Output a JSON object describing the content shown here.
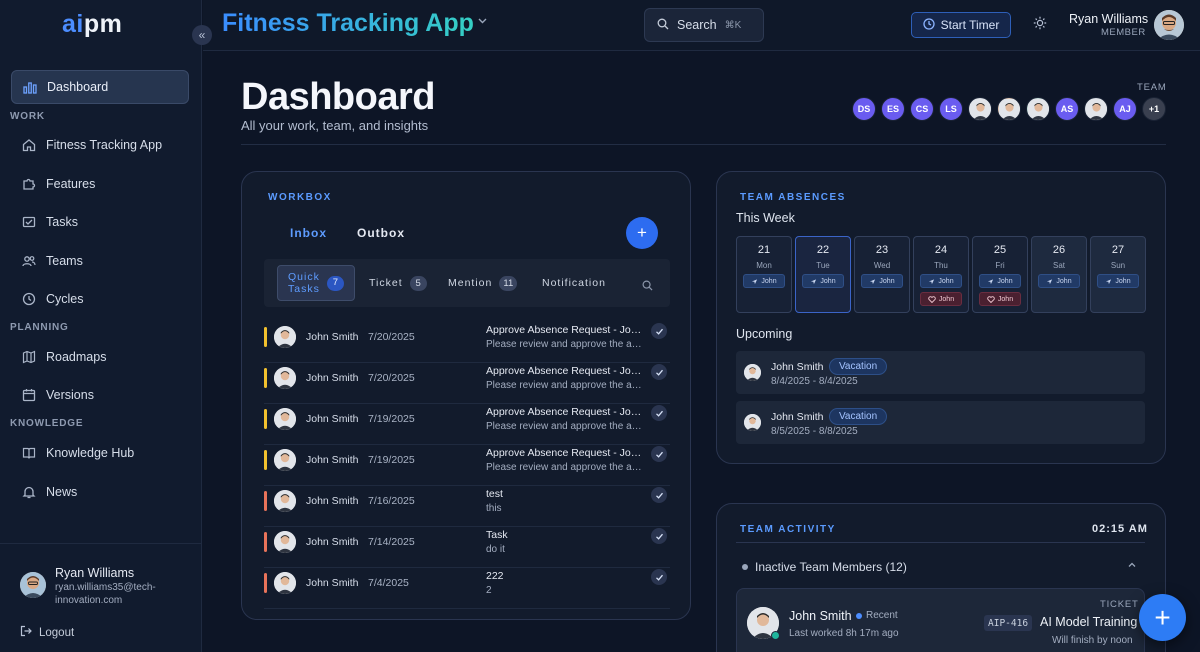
{
  "brand": {
    "logo_a": "ai",
    "logo_b": "pm"
  },
  "app": {
    "title": "Fitness Tracking App"
  },
  "search": {
    "label": "Search",
    "shortcut": "⌘K"
  },
  "header": {
    "timer_label": "Start Timer",
    "user_name": "Ryan Williams",
    "user_role": "MEMBER"
  },
  "sidebar": {
    "dashboard": "Dashboard",
    "section_work": "WORK",
    "work_items": [
      "Fitness Tracking App",
      "Features",
      "Tasks",
      "Teams",
      "Cycles"
    ],
    "section_planning": "PLANNING",
    "planning_items": [
      "Roadmaps",
      "Versions"
    ],
    "section_knowledge": "KNOWLEDGE",
    "knowledge_items": [
      "Knowledge Hub",
      "News"
    ],
    "user_name": "Ryan Williams",
    "user_email": "ryan.williams35@tech-innovation.com",
    "logout": "Logout"
  },
  "page": {
    "title": "Dashboard",
    "subtitle": "All your work, team, and insights",
    "team_label": "TEAM"
  },
  "team": [
    {
      "initials": "DS",
      "color": "#6a5cf0"
    },
    {
      "initials": "ES",
      "color": "#6a5cf0"
    },
    {
      "initials": "CS",
      "color": "#6a5cf0"
    },
    {
      "initials": "LS",
      "color": "#6a5cf0"
    },
    {
      "initials": "",
      "color": "#d9dde3"
    },
    {
      "initials": "",
      "color": "#e3c9b5"
    },
    {
      "initials": "",
      "color": "#c9dedb"
    },
    {
      "initials": "AS",
      "color": "#6a5cf0"
    },
    {
      "initials": "",
      "color": "#d9dde3"
    },
    {
      "initials": "AJ",
      "color": "#6a5cf0"
    },
    {
      "initials": "+1",
      "color": "#3a4050"
    }
  ],
  "workbox": {
    "label": "WORKBOX",
    "tab_inbox": "Inbox",
    "tab_outbox": "Outbox",
    "sub_quick_1": "Quick",
    "sub_quick_2": "Tasks",
    "sub_quick_count": "7",
    "sub_ticket": "Ticket",
    "sub_ticket_count": "5",
    "sub_mention": "Mention",
    "sub_mention_count": "11",
    "sub_notification": "Notification",
    "tasks": [
      {
        "name": "John Smith",
        "date": "7/20/2025",
        "title": "Approve Absence Request - John Smith",
        "desc": "Please review and approve the absence request",
        "color": "#f2c12e"
      },
      {
        "name": "John Smith",
        "date": "7/20/2025",
        "title": "Approve Absence Request - John Smith",
        "desc": "Please review and approve the absence request",
        "color": "#f2c12e"
      },
      {
        "name": "John Smith",
        "date": "7/19/2025",
        "title": "Approve Absence Request - John Smith",
        "desc": "Please review and approve the absence request",
        "color": "#f2c12e"
      },
      {
        "name": "John Smith",
        "date": "7/19/2025",
        "title": "Approve Absence Request - John Smith",
        "desc": "Please review and approve the absence request",
        "color": "#f2c12e"
      },
      {
        "name": "John Smith",
        "date": "7/16/2025",
        "title": "test",
        "desc": "this",
        "color": "#e8735a"
      },
      {
        "name": "John Smith",
        "date": "7/14/2025",
        "title": "Task",
        "desc": "do it",
        "color": "#e8735a"
      },
      {
        "name": "John Smith",
        "date": "7/4/2025",
        "title": "222",
        "desc": "2",
        "color": "#e8735a"
      }
    ]
  },
  "absences": {
    "label": "TEAM ABSENCES",
    "this_week": "This Week",
    "days": [
      {
        "num": "21",
        "name": "Mon",
        "chips": [
          "John"
        ],
        "sick": []
      },
      {
        "num": "22",
        "name": "Tue",
        "chips": [
          "John"
        ],
        "sick": []
      },
      {
        "num": "23",
        "name": "Wed",
        "chips": [
          "John"
        ],
        "sick": []
      },
      {
        "num": "24",
        "name": "Thu",
        "chips": [
          "John"
        ],
        "sick": [
          "John"
        ]
      },
      {
        "num": "25",
        "name": "Fri",
        "chips": [
          "John"
        ],
        "sick": [
          "John"
        ]
      },
      {
        "num": "26",
        "name": "Sat",
        "chips": [
          "John"
        ],
        "sick": []
      },
      {
        "num": "27",
        "name": "Sun",
        "chips": [
          "John"
        ],
        "sick": []
      }
    ],
    "upcoming": "Upcoming",
    "items": [
      {
        "name": "John Smith",
        "tag": "Vacation",
        "dates": "8/4/2025 - 8/4/2025"
      },
      {
        "name": "John Smith",
        "tag": "Vacation",
        "dates": "8/5/2025 - 8/8/2025"
      }
    ]
  },
  "activity": {
    "label": "TEAM ACTIVITY",
    "time": "02:15 AM",
    "inactive": "Inactive Team Members (12)",
    "member_name": "John Smith",
    "member_recent": "Recent",
    "member_worked": "Last worked 8h 17m ago",
    "ticket_label": "TICKET",
    "ticket_id": "AIP-416",
    "ticket_title": "AI Model Training",
    "ticket_eta": "Will finish by noon"
  }
}
